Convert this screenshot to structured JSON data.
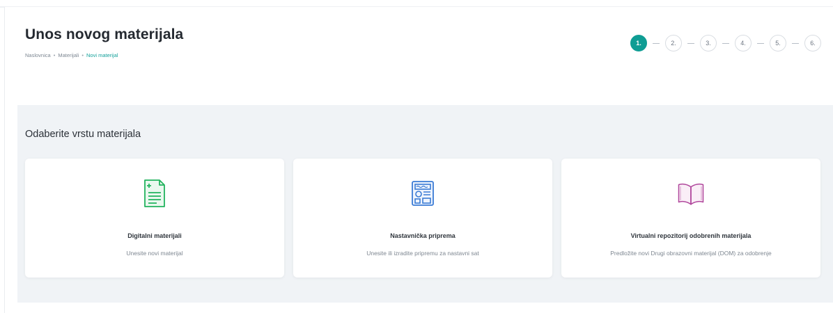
{
  "header": {
    "title": "Unos novog materijala",
    "breadcrumb": {
      "items": [
        "Naslovnica",
        "Materijali",
        "Novi materijal"
      ],
      "separator": "•"
    }
  },
  "stepper": {
    "steps": [
      "1.",
      "2.",
      "3.",
      "4.",
      "5.",
      "6."
    ],
    "active_step": "1.",
    "connector": "—"
  },
  "section": {
    "title": "Odaberite vrstu materijala"
  },
  "cards": [
    {
      "title": "Digitalni materijali",
      "subtitle": "Unesite novi materijal",
      "icon": "document-plus-icon",
      "icon_color": "#22b35e"
    },
    {
      "title": "Nastavnička priprema",
      "subtitle": "Unesite ili izradite pripremu za nastavni sat",
      "icon": "newspaper-icon",
      "icon_color": "#3a7bd5"
    },
    {
      "title": "Virtualni repozitorij odobrenih materijala",
      "subtitle": "Predložite novi Drugi obrazovni materijal (DOM) za odobrenje",
      "icon": "open-book-icon",
      "icon_color": "#b0479c"
    }
  ],
  "colors": {
    "accent": "#0f9d94",
    "breadcrumb_active": "#14a19b",
    "section_bg": "#f0f3f6"
  }
}
